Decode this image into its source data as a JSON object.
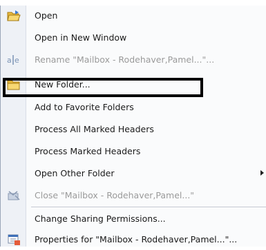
{
  "menu": {
    "items": [
      {
        "label": "Open",
        "icon": "open-folder-icon",
        "enabled": true
      },
      {
        "label": "Open in New Window",
        "icon": "",
        "enabled": true
      },
      {
        "label": "Rename \"Mailbox - Rodehaver,Pamel...\"...",
        "icon": "rename-icon",
        "enabled": false
      },
      {
        "label": "New Folder...",
        "icon": "new-folder-icon",
        "enabled": true
      },
      {
        "label": "Add to Favorite Folders",
        "icon": "",
        "enabled": true
      },
      {
        "label": "Process All Marked Headers",
        "icon": "",
        "enabled": true
      },
      {
        "label": "Process Marked Headers",
        "icon": "",
        "enabled": true
      },
      {
        "label": "Open Other Folder",
        "icon": "",
        "enabled": true,
        "submenu": true
      },
      {
        "label": "Close \"Mailbox - Rodehaver,Pamel...\"",
        "icon": "close-mailbox-icon",
        "enabled": false
      },
      {
        "label": "Change Sharing Permissions...",
        "icon": "",
        "enabled": true
      },
      {
        "label": "Properties for \"Mailbox - Rodehaver,Pamel...\"...",
        "icon": "properties-icon",
        "enabled": true
      }
    ]
  },
  "colors": {
    "highlight_border": "#000000",
    "disabled_text": "#9a9a9a",
    "folder_yellow": "#f2c94c"
  }
}
